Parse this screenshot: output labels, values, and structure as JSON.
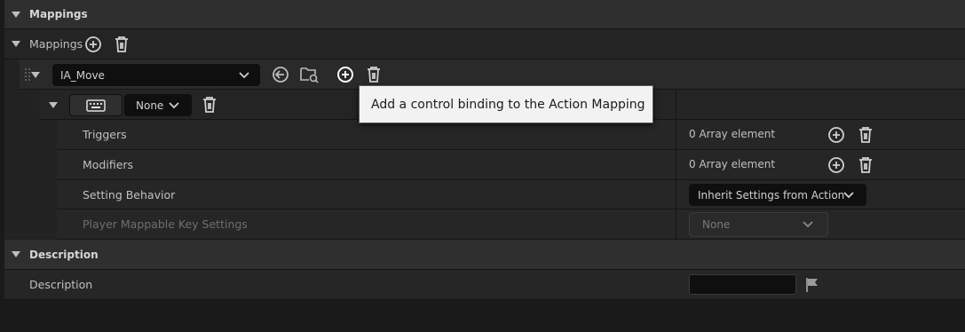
{
  "categories": {
    "mappings_title": "Mappings",
    "description_title": "Description"
  },
  "mappings_array": {
    "label": "Mappings"
  },
  "action_mapping": {
    "selected_action": "IA_Move",
    "key_selector_value": "None"
  },
  "tooltip": {
    "text": "Add a control binding to the Action Mapping"
  },
  "properties": {
    "triggers_label": "Triggers",
    "triggers_value": "0 Array element",
    "modifiers_label": "Modifiers",
    "modifiers_value": "0 Array element",
    "setting_behavior_label": "Setting Behavior",
    "setting_behavior_value": "Inherit Settings from Action",
    "player_mappable_label": "Player Mappable Key Settings",
    "player_mappable_value": "None"
  },
  "description": {
    "label": "Description",
    "value": ""
  },
  "icons": [
    "triangle-expand-icon",
    "plus-circle-icon",
    "trash-icon",
    "chevron-down-icon",
    "back-arrow-icon",
    "browse-folder-icon",
    "keyboard-icon",
    "flag-icon",
    "drag-handle-icon"
  ],
  "colors": {
    "panel_bg": "#1a1a1a",
    "category_bg": "#2f2f2f",
    "row_bg": "#262626",
    "combo_bg": "#0f0f0f",
    "tooltip_bg": "#f2f2f2"
  }
}
